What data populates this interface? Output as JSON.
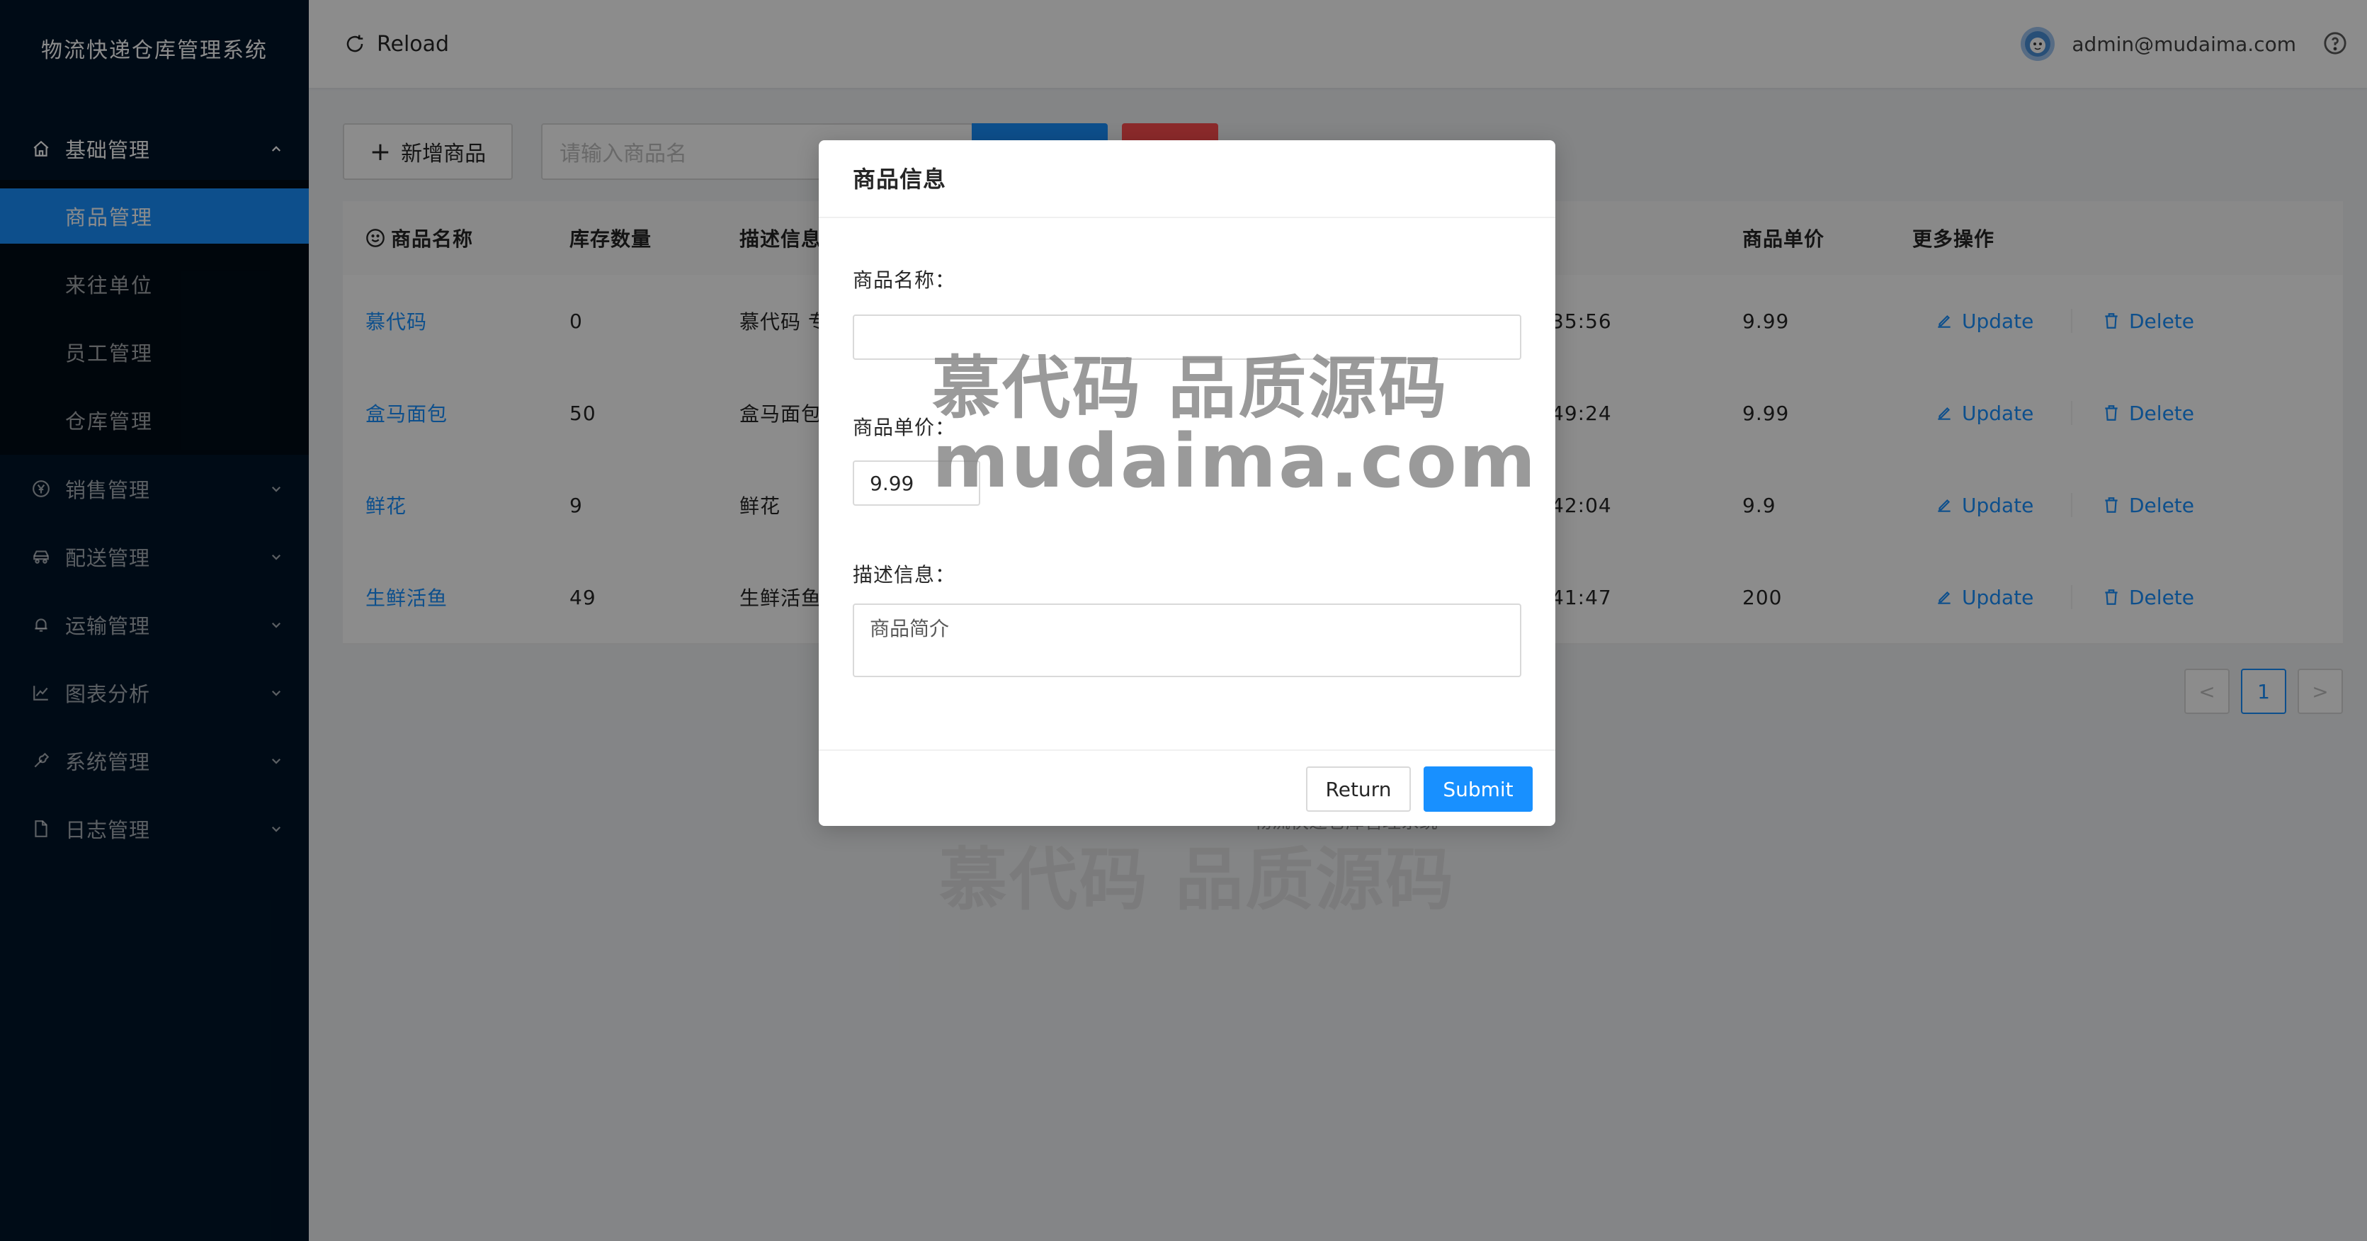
{
  "app": {
    "title": "物流快递仓库管理系统"
  },
  "sidebar": {
    "groups": [
      {
        "label": "基础管理",
        "icon": "home-icon",
        "open": true
      },
      {
        "label": "销售管理",
        "icon": "yen-circle-icon"
      },
      {
        "label": "配送管理",
        "icon": "car-icon"
      },
      {
        "label": "运输管理",
        "icon": "bell-icon"
      },
      {
        "label": "图表分析",
        "icon": "line-chart-icon"
      },
      {
        "label": "系统管理",
        "icon": "wrench-icon"
      },
      {
        "label": "日志管理",
        "icon": "file-icon"
      }
    ],
    "sub_items": [
      {
        "label": "商品管理",
        "active": true
      },
      {
        "label": "来往单位"
      },
      {
        "label": "员工管理"
      },
      {
        "label": "仓库管理"
      }
    ]
  },
  "header": {
    "reload_label": "Reload",
    "user_email": "admin@mudaima.com"
  },
  "toolbar": {
    "add_label": "新增商品",
    "search_placeholder": "请输入商品名"
  },
  "table": {
    "columns": [
      "商品名称",
      "库存数量",
      "描述信息",
      "商品单价",
      "更多操作"
    ],
    "rows": [
      {
        "name": "慕代码",
        "stock": "0",
        "desc": "慕代码 专",
        "time": "35:56",
        "price": "9.99"
      },
      {
        "name": "盒马面包",
        "stock": "50",
        "desc": "盒马面包",
        "time": "49:24",
        "price": "9.99"
      },
      {
        "name": "鲜花",
        "stock": "9",
        "desc": "鲜花",
        "time": "42:04",
        "price": "9.9"
      },
      {
        "name": "生鲜活鱼",
        "stock": "49",
        "desc": "生鲜活鱼",
        "time": "41:47",
        "price": "200"
      }
    ],
    "update_label": "Update",
    "delete_label": "Delete"
  },
  "pagination": {
    "prev": "<",
    "current": "1",
    "next": ">"
  },
  "footer": {
    "text": "物流快递仓库管理系统"
  },
  "modal": {
    "title": "商品信息",
    "name_label": "商品名称：",
    "name_value": "",
    "price_label": "商品单价：",
    "price_value": "9.99",
    "desc_label": "描述信息：",
    "desc_placeholder": "商品简介",
    "return_label": "Return",
    "submit_label": "Submit"
  },
  "watermark": {
    "line1": "慕代码 品质源码",
    "line2": "mudaima.com",
    "line3": "慕代码 品质源码"
  },
  "colors": {
    "sidebar_bg": "#001529",
    "primary": "#1890ff",
    "danger": "#ff4d4f"
  }
}
